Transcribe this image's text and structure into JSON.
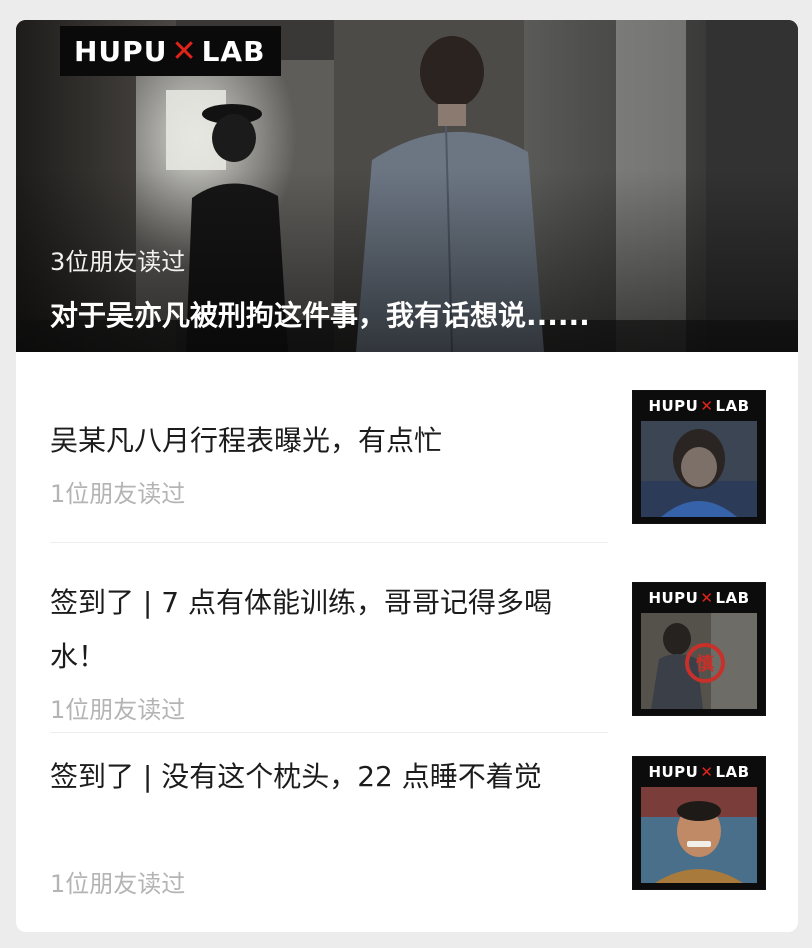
{
  "hero": {
    "brand": {
      "left": "HUPU",
      "x": "✕",
      "right": "LAB"
    },
    "readers": "3位朋友读过",
    "title": "对于吴亦凡被刑拘这件事，我有话想说......"
  },
  "articles": [
    {
      "title": "吴某凡八月行程表曝光，有点忙",
      "readers": "1位朋友读过",
      "thumb_brand": {
        "left": "HUPU",
        "x": "✕",
        "right": "LAB"
      }
    },
    {
      "title": "签到了 | 7 点有体能训练，哥哥记得多喝水！",
      "readers": "1位朋友读过",
      "thumb_brand": {
        "left": "HUPU",
        "x": "✕",
        "right": "LAB"
      },
      "stamp_text": "慎"
    },
    {
      "title": "签到了 | 没有这个枕头，22 点睡不着觉",
      "readers": "1位朋友读过",
      "thumb_brand": {
        "left": "HUPU",
        "x": "✕",
        "right": "LAB"
      }
    }
  ],
  "colors": {
    "brand_accent": "#e2231a",
    "meta_text": "#b4b4b4",
    "title_text": "#1c1c1c"
  }
}
